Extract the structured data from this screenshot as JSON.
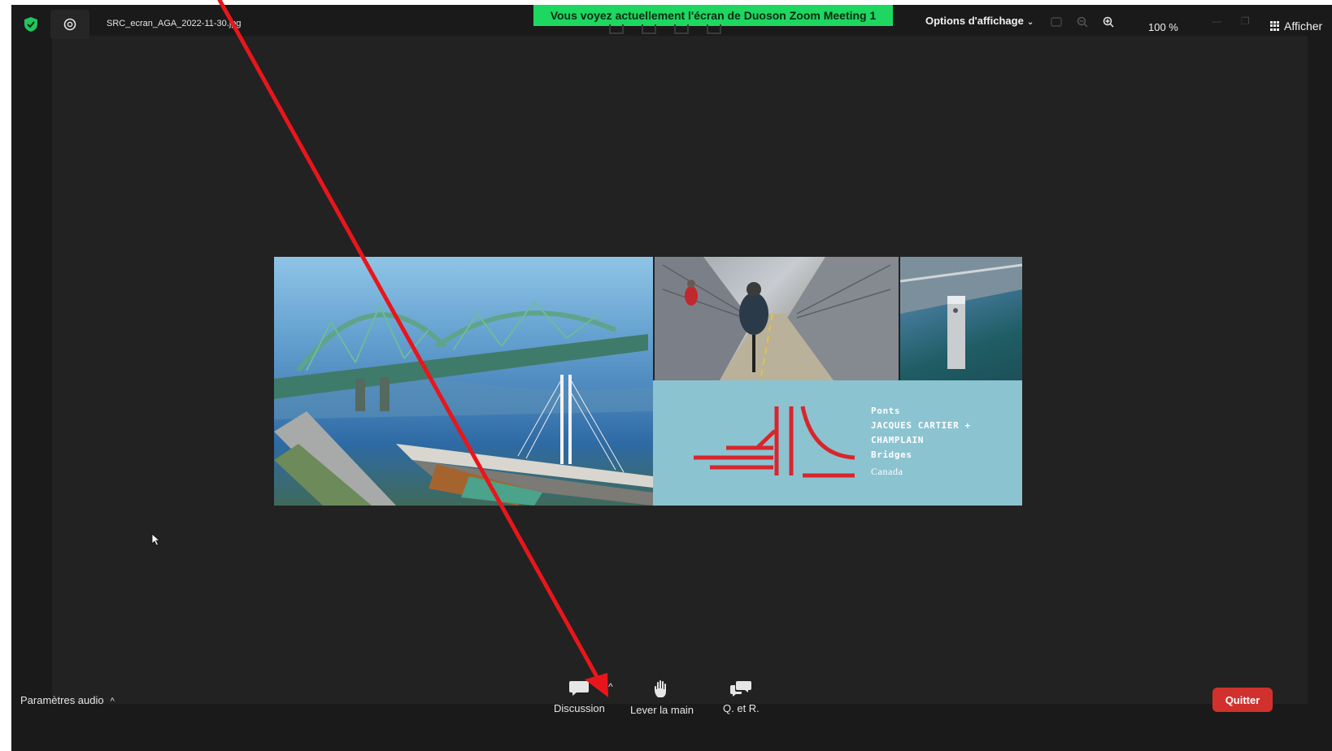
{
  "topbar": {
    "file_title": "SRC_ecran_AGA_2022-11-30.jpg",
    "share_banner": "Vous voyez actuellement l'écran de Duoson Zoom Meeting 1",
    "view_options_label": "Options d'affichage",
    "zoom_level": "100 %",
    "show_label": "Afficher"
  },
  "shared_image": {
    "brand_line1": "Ponts",
    "brand_line2": "JACQUES CARTIER +",
    "brand_line3": "CHAMPLAIN",
    "brand_line4": "Bridges",
    "brand_canada": "Canada"
  },
  "bottombar": {
    "audio_settings": "Paramètres audio",
    "chat_label": "Discussion",
    "raise_hand_label": "Lever la main",
    "qa_label": "Q. et R.",
    "quit_label": "Quitter"
  },
  "colors": {
    "share_banner": "#1ed760",
    "quit": "#d0312d",
    "annotation_arrow": "#e8161b",
    "security_shield": "#22c55e",
    "brand_red": "#d8262c",
    "brand_panel": "#8cc3d1"
  },
  "icons": [
    "shield-check-icon",
    "camera-icon",
    "zoom-out-icon",
    "zoom-in-icon",
    "grid-icon",
    "chat-icon",
    "raise-hand-icon",
    "qa-icon",
    "mouse-cursor-icon"
  ]
}
